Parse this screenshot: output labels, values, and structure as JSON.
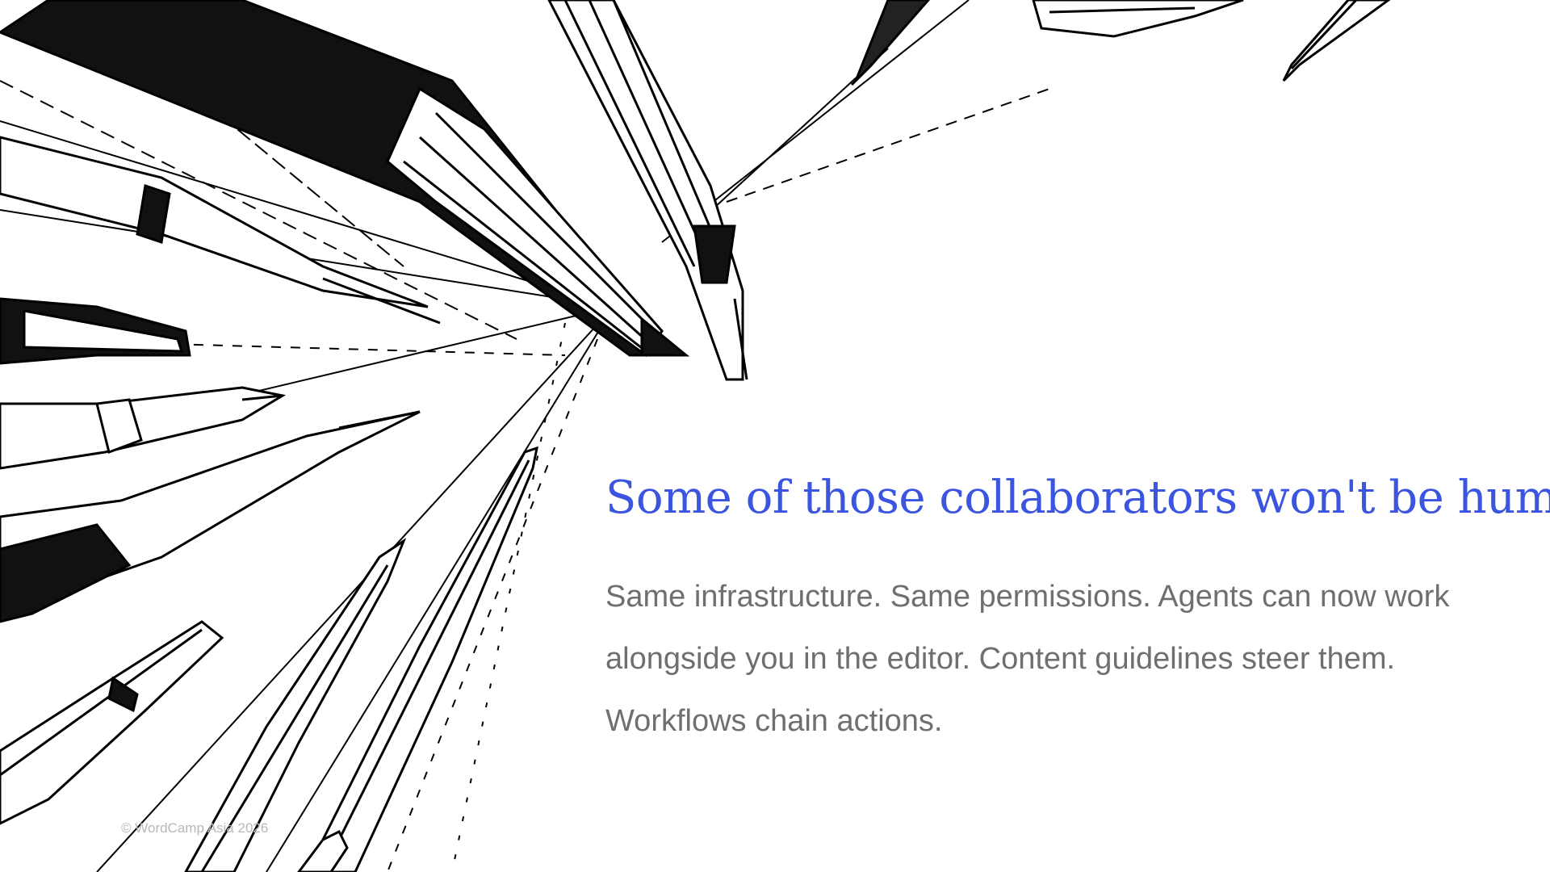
{
  "slide": {
    "title": "Some of those collaborators won't be human.",
    "body": "Same infrastructure. Same permissions. Agents can now work alongside you in the editor. Content guidelines steer them. Workflows chain actions.",
    "footer": "© WordCamp Asia 2026",
    "illustration": "pens-sketch-illustration"
  },
  "colors": {
    "title": "#3c55e0",
    "body": "#6f6f6f",
    "footer": "#b8b8b8",
    "background": "#ffffff"
  }
}
